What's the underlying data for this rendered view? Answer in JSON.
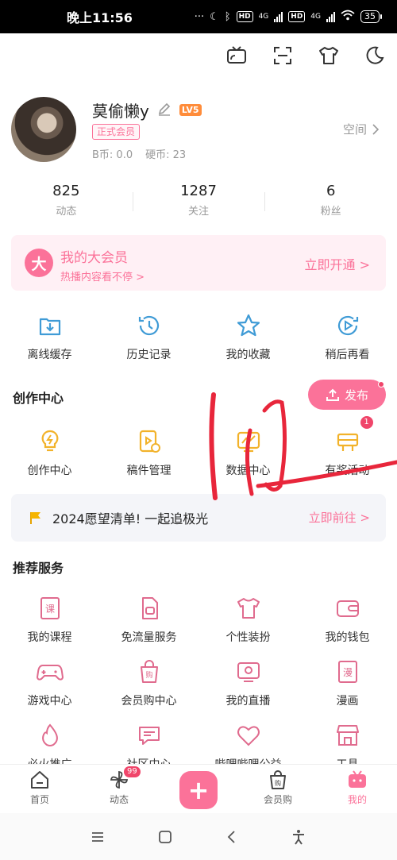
{
  "status_bar": {
    "time": "晚上11:56",
    "battery": "35",
    "net1": "4G",
    "net2": "4G",
    "hd": "HD"
  },
  "profile": {
    "name": "莫偷懒y",
    "level": "LV5",
    "member_tag": "正式会员",
    "b_coin": "B币: 0.0",
    "hard_coin": "硬币: 23",
    "space": "空间"
  },
  "stats": [
    {
      "num": "825",
      "label": "动态"
    },
    {
      "num": "1287",
      "label": "关注"
    },
    {
      "num": "6",
      "label": "粉丝"
    }
  ],
  "vip": {
    "icon": "大",
    "title": "我的大会员",
    "subtitle": "热播内容看不停 >",
    "action": "立即开通 >"
  },
  "quick": [
    {
      "label": "离线缓存",
      "icon": "download-box-icon"
    },
    {
      "label": "历史记录",
      "icon": "history-clock-icon"
    },
    {
      "label": "我的收藏",
      "icon": "star-icon"
    },
    {
      "label": "稍后再看",
      "icon": "play-later-icon"
    }
  ],
  "creator": {
    "title": "创作中心",
    "publish": "发布",
    "items": [
      {
        "label": "创作中心",
        "icon": "bulb-icon"
      },
      {
        "label": "稿件管理",
        "icon": "manuscript-icon"
      },
      {
        "label": "数据中心",
        "icon": "data-chart-icon"
      },
      {
        "label": "有奖活动",
        "icon": "gift-flag-icon",
        "badge": "1"
      }
    ]
  },
  "wish": {
    "text": "2024愿望清单! 一起追极光",
    "action": "立即前往 >"
  },
  "services": {
    "title": "推荐服务",
    "row1": [
      {
        "label": "我的课程",
        "icon": "course-book-icon"
      },
      {
        "label": "免流量服务",
        "icon": "sim-card-icon"
      },
      {
        "label": "个性装扮",
        "icon": "tshirt-icon"
      },
      {
        "label": "我的钱包",
        "icon": "wallet-icon"
      }
    ],
    "row2": [
      {
        "label": "游戏中心",
        "icon": "gamepad-icon"
      },
      {
        "label": "会员购中心",
        "icon": "shopping-bag-icon"
      },
      {
        "label": "我的直播",
        "icon": "live-tv-icon"
      },
      {
        "label": "漫画",
        "icon": "comic-book-icon"
      }
    ],
    "row3": [
      {
        "label": "必火推广",
        "icon": "fire-icon"
      },
      {
        "label": "社区中心",
        "icon": "chat-bubble-icon"
      },
      {
        "label": "哔哩哔哩公益",
        "icon": "heart-hands-icon"
      },
      {
        "label": "工具",
        "icon": "toolbox-icon"
      }
    ]
  },
  "tabbar": [
    {
      "label": "首页",
      "icon": "home-icon"
    },
    {
      "label": "动态",
      "icon": "pinwheel-icon",
      "badge": "99"
    },
    {
      "label": "",
      "icon": "plus-icon"
    },
    {
      "label": "会员购",
      "icon": "shopping-bag-icon"
    },
    {
      "label": "我的",
      "icon": "tv-icon",
      "active": true
    }
  ],
  "colors": {
    "accent": "#fb7299",
    "vip_bg": "#fff0f5",
    "level": "#ff8c3a",
    "scribble": "#e8263b",
    "icon_blue": "#3f9bd6",
    "icon_yellow": "#f2b22a"
  }
}
